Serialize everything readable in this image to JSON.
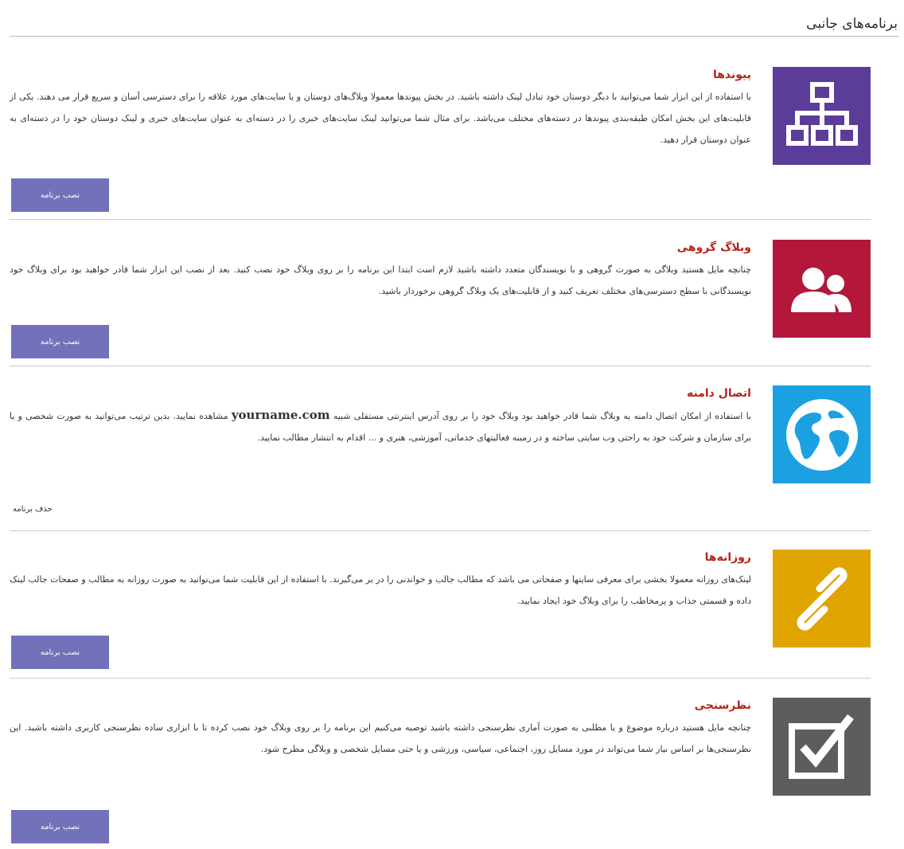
{
  "page": {
    "title": "برنامه‌های جانبی"
  },
  "items": [
    {
      "title": "پیوندها",
      "icon": "sitemap-icon",
      "icon_color": "#5b3d99",
      "description": "با استفاده از این ابزار شما می‌توانید با دیگر دوستان خود تبادل لینک داشته باشید. در بخش پیوندها معمولا وبلاگ‌های دوستان و یا سایت‌های مورد علاقه را برای دسترسی آسان و سریع قرار می دهند. یکی از قابلیت‌های این بخش امکان طبقه‌بندی پیوندها در دسته‌های مختلف می‌باشد. برای مثال شما می‌توانید لینک سایت‌های خبری را در دسته‌ای به عنوان سایت‌های خبری و لینک دوستان خود را در دسته‌ای به عنوان دوستان قرار دهید.",
      "action_label": "نصب برنامه",
      "action_type": "button"
    },
    {
      "title": "وبلاگ گروهی",
      "icon": "users-icon",
      "icon_color": "#b3173a",
      "description": "چنانچه مایل هستید وبلاگی به صورت گروهی و با نویسندگان متعدد داشته باشید لازم است ابتدا این برنامه را بر روی وبلاگ خود نصب کنید. بعد از نصب این ابزار شما قادر خواهید بود برای وبلاگ خود نویسندگانی با سطح دسترسی‌های مختلف تعریف کنید و از قابلیت‌های یک وبلاگ گروهی برخوردار باشید.",
      "action_label": "نصب برنامه",
      "action_type": "button"
    },
    {
      "title": "اتصال دامنه",
      "icon": "globe-icon",
      "icon_color": "#1ba1e2",
      "description_pre": "با استفاده از امکان اتصال دامنه به وبلاگ شما قادر خواهید بود وبلاگ خود را بر روی آدرس اینترنتی مستقلی شبیه",
      "domain_example": "yourname.com",
      "description_post": "مشاهده نمایید. بدین ترتیب می‌توانید به صورت شخصی و یا برای سازمان و شرکت خود به راحتی وب سایتی ساخته و در زمینه فعالیتهای خدماتی، آموزشی، هنری و ... اقدام به انتشار مطالب نمایید.",
      "action_label": "حذف برنامه",
      "action_type": "link"
    },
    {
      "title": "روزانه‌ها",
      "icon": "link-icon",
      "icon_color": "#e0a400",
      "description": "لینک‌های روزانه معمولا بخشی برای معرفی سایتها و صفحاتی می باشد که مطالب جالب و خواندنی را در بر می‌گیرند. با استفاده از این قابلیت شما می‌توانید به صورت روزانه به مطالب و صفحات جالب لینک داده و قسمتی جذاب و پرمخاطب را برای وبلاگ خود ایجاد نمایید.",
      "action_label": "نصب برنامه",
      "action_type": "button"
    },
    {
      "title": "نظرسنجی",
      "icon": "checkbox-icon",
      "icon_color": "#5d5d5d",
      "description": "چنانچه مایل هستید درباره موضوع و یا مطلبی به صورت آماری نظرسنجی داشته باشید توصیه می‌کنیم این برنامه را بر روی وبلاگ خود نصب کرده تا با ابزاری ساده نظرسنجی کاربری داشته باشید. این نظرسنجی‌ها بر اساس نیاز شما می‌تواند در مورد مسایل روز، اجتماعی، سیاسی، ورزشی و یا حتی مسایل شخصی و وبلاگی مطرح شود.",
      "action_label": "نصب برنامه",
      "action_type": "button"
    }
  ]
}
